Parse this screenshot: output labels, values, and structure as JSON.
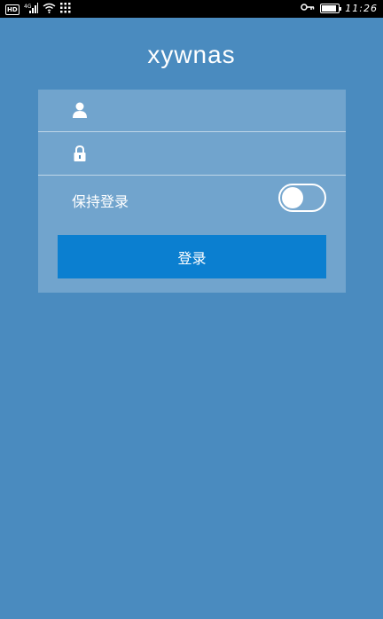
{
  "status_bar": {
    "hd_badge": "HD",
    "network": "4G",
    "time": "11:26",
    "battery_level": 0.9,
    "icons": [
      "hd-badge-icon",
      "signal-icon",
      "wifi-icon",
      "apps-grid-icon",
      "key-icon",
      "battery-icon"
    ]
  },
  "app": {
    "title": "xywnas"
  },
  "login": {
    "username_value": "",
    "username_icon": "user-icon",
    "password_value": "",
    "password_icon": "lock-icon",
    "keep_login_label": "保持登录",
    "keep_login_on": false,
    "submit_label": "登录"
  },
  "colors": {
    "background": "#4a8bbf",
    "button": "#0b7fd0",
    "status_bar": "#000000"
  }
}
